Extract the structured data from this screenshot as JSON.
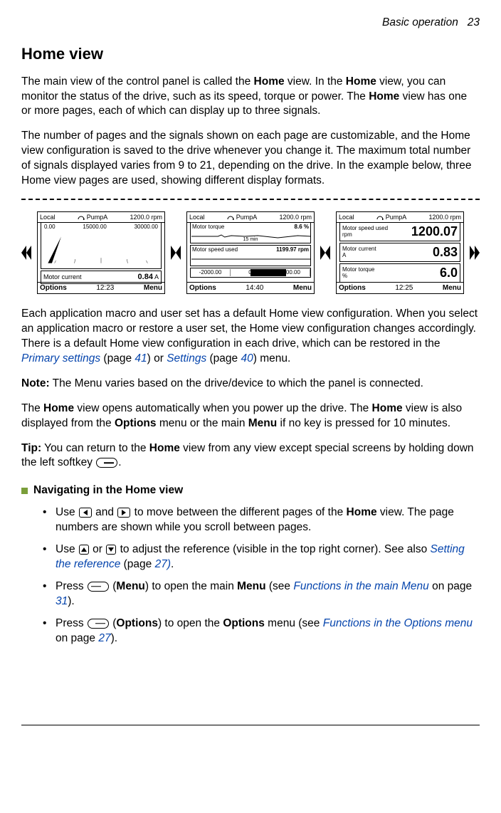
{
  "header": {
    "section": "Basic operation",
    "page": "23"
  },
  "title": "Home view",
  "para1": {
    "t1": "The main view of the control panel is called the ",
    "b1": "Home",
    "t2": " view. In the ",
    "b2": "Home",
    "t3": " view, you can monitor the status of the drive, such as its speed, torque or power. The ",
    "b3": "Home",
    "t4": " view has one or more pages, each of which can display up to three signals."
  },
  "para2": "The number of pages and the signals shown on each page are customizable, and the Home view configuration is saved to the drive whenever you change it. The maximum total number of signals displayed varies from 9 to 21, depending on the drive. In the example below, three Home view pages are used, showing different display formats.",
  "figures": {
    "s1": {
      "local": "Local",
      "pump": "PumpA",
      "ref": "1200.0 rpm",
      "ticks": [
        "0.00",
        "15000.00",
        "30000.00"
      ],
      "currentLabel": "Motor current",
      "current": "0.84",
      "unit": "A",
      "opt": "Options",
      "time": "12:23",
      "menu": "Menu"
    },
    "s2": {
      "local": "Local",
      "pump": "PumpA",
      "ref": "1200.0 rpm",
      "torqueLabel": "Motor torque",
      "torque": "8.6",
      "torqueUnit": "%",
      "mins": "15 min",
      "speedLabel": "Motor speed used",
      "speed": "1199.97",
      "speedUnit": "rpm",
      "barL": "-2000.00",
      "barC": "0",
      "barR": "2000.00",
      "opt": "Options",
      "time": "14:40",
      "menu": "Menu"
    },
    "s3": {
      "local": "Local",
      "pump": "PumpA",
      "ref": "1200.0 rpm",
      "r1l": "Motor speed used",
      "r1u": "rpm",
      "r1v": "1200.07",
      "r2l": "Motor current",
      "r2u": "A",
      "r2v": "0.83",
      "r3l": "Motor torque",
      "r3u": "%",
      "r3v": "6.0",
      "opt": "Options",
      "time": "12:25",
      "menu": "Menu"
    }
  },
  "para3": {
    "t1": "Each application macro and user set has a default Home view configuration. When you select an application macro or restore a user set, the Home view configuration changes accordingly. There is a default Home view configuration in each drive, which can be restored in the ",
    "l1": "Primary settings",
    "t2": " (page ",
    "p1": "41",
    "t3": ") or ",
    "l2": "Settings",
    "t4": " (page ",
    "p2": "40",
    "t5": ") menu."
  },
  "note": {
    "b": "Note:",
    "t": " The Menu varies based on the drive/device to which the panel is connected."
  },
  "para4": {
    "t1": "The ",
    "b1": "Home",
    "t2": " view opens automatically when you power up the drive. The ",
    "b2": "Home",
    "t3": " view is also displayed from the ",
    "b3": "Options",
    "t4": " menu or the main ",
    "b4": "Menu",
    "t5": " if no key is pressed for 10 minutes."
  },
  "tip": {
    "b": "Tip:",
    "t1": " You can return to the ",
    "b1": "Home",
    "t2": " view from any view except special screens by holding down the left softkey ",
    "dot": "."
  },
  "subheading": "Navigating in the Home view",
  "bullets": {
    "b1": {
      "t1": "Use ",
      "t2": " and ",
      "t3": " to move between the different pages of the ",
      "b1": "Home",
      "t4": " view. The page numbers are shown while you scroll between pages."
    },
    "b2": {
      "t1": "Use ",
      "t2": " or ",
      "t3": " to adjust the reference (visible in the top right corner). See also ",
      "l1": "Setting the reference",
      "t4": " (page ",
      "p1": "27)",
      "t5": "."
    },
    "b3": {
      "t1": "Press ",
      "t2": " (",
      "b1": "Menu",
      "t3": ") to open the main ",
      "b2": "Menu",
      "t4": " (see ",
      "l1": "Functions in the main Menu",
      "t5": " on page ",
      "p1": "31",
      "t6": ")."
    },
    "b4": {
      "t1": "Press ",
      "t2": " (",
      "b1": "Options",
      "t3": ") to open the ",
      "b2": "Options",
      "t4": " menu (see ",
      "l1": "Functions in the Options menu",
      "t5": " on page ",
      "p1": "27",
      "t6": ")."
    }
  }
}
